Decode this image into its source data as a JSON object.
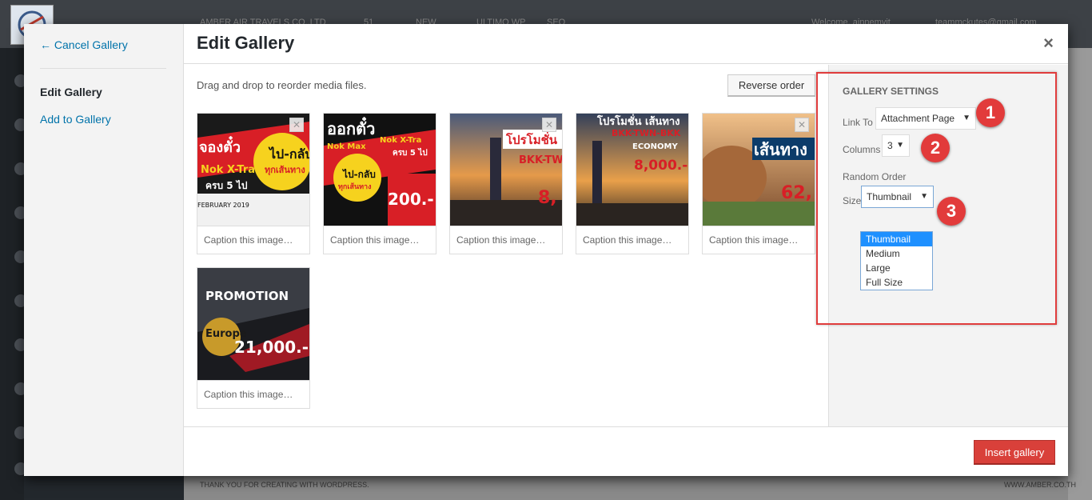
{
  "adminbar": {
    "site_name": "AMBER AIR TRAVELS CO.,LTD",
    "comments": "51",
    "new": "NEW",
    "ultimo": "ULTIMO WP",
    "seo": "SEO",
    "welcome": "Welcome, ajnnemvit",
    "email": "teammckutes@gmail.com"
  },
  "footer": {
    "left": "THANK YOU FOR CREATING WITH WORDPRESS.",
    "right": "WWW.AMBER.CO.TH"
  },
  "menu": {
    "cancel": "← Cancel Gallery",
    "edit": "Edit Gallery",
    "add": "Add to Gallery"
  },
  "title": "Edit Gallery",
  "close": "×",
  "instructions": "Drag and drop to reorder media files.",
  "reverse_label": "Reverse order",
  "caption_placeholder": "Caption this image…",
  "thumbs": [
    {
      "caption": "Caption this image…",
      "texts": [
        "จองตั๋ว",
        "ไป-กลับ",
        "ทุกเส้นทาง",
        "Nok X-Tra",
        "ครบ 5 ไป",
        "FEBRUARY 2019"
      ]
    },
    {
      "caption": "Caption this image…",
      "texts": [
        "ออกตั๋ว",
        "Nok Max",
        "Nok X-Tra",
        "ครบ 5 ไป",
        "ไป-กลับ",
        "ทุกเส้นทาง",
        "200.-"
      ]
    },
    {
      "caption": "Caption this image…",
      "texts": [
        "โปรโมชั่น",
        "BKK-TW",
        "8,"
      ]
    },
    {
      "caption": "Caption this image…",
      "texts": [
        "โปรโมชั่น เส้นทาง",
        "BKK-TWN-BKK",
        "ECONOMY",
        "8,000.-"
      ]
    },
    {
      "caption": "Caption this image…",
      "texts": [
        "เส้นทาง",
        "62,"
      ]
    },
    {
      "caption": "Caption this image…",
      "texts": [
        "PROMOTION",
        "Europe",
        "21,000.-"
      ]
    }
  ],
  "settings": {
    "heading": "Gallery Settings",
    "link_label": "Link To",
    "link_value": "Attachment Page",
    "columns_label": "Columns",
    "columns_value": "3",
    "random_label": "Random Order",
    "size_label": "Size",
    "size_value": "Thumbnail",
    "size_options": [
      "Thumbnail",
      "Medium",
      "Large",
      "Full Size"
    ]
  },
  "badges": [
    "1",
    "2",
    "3"
  ],
  "insert_label": "Insert gallery",
  "colors": {
    "accent_link": "#0073aa",
    "insert_button": "#d9403a",
    "callout": "#e23b3b"
  }
}
